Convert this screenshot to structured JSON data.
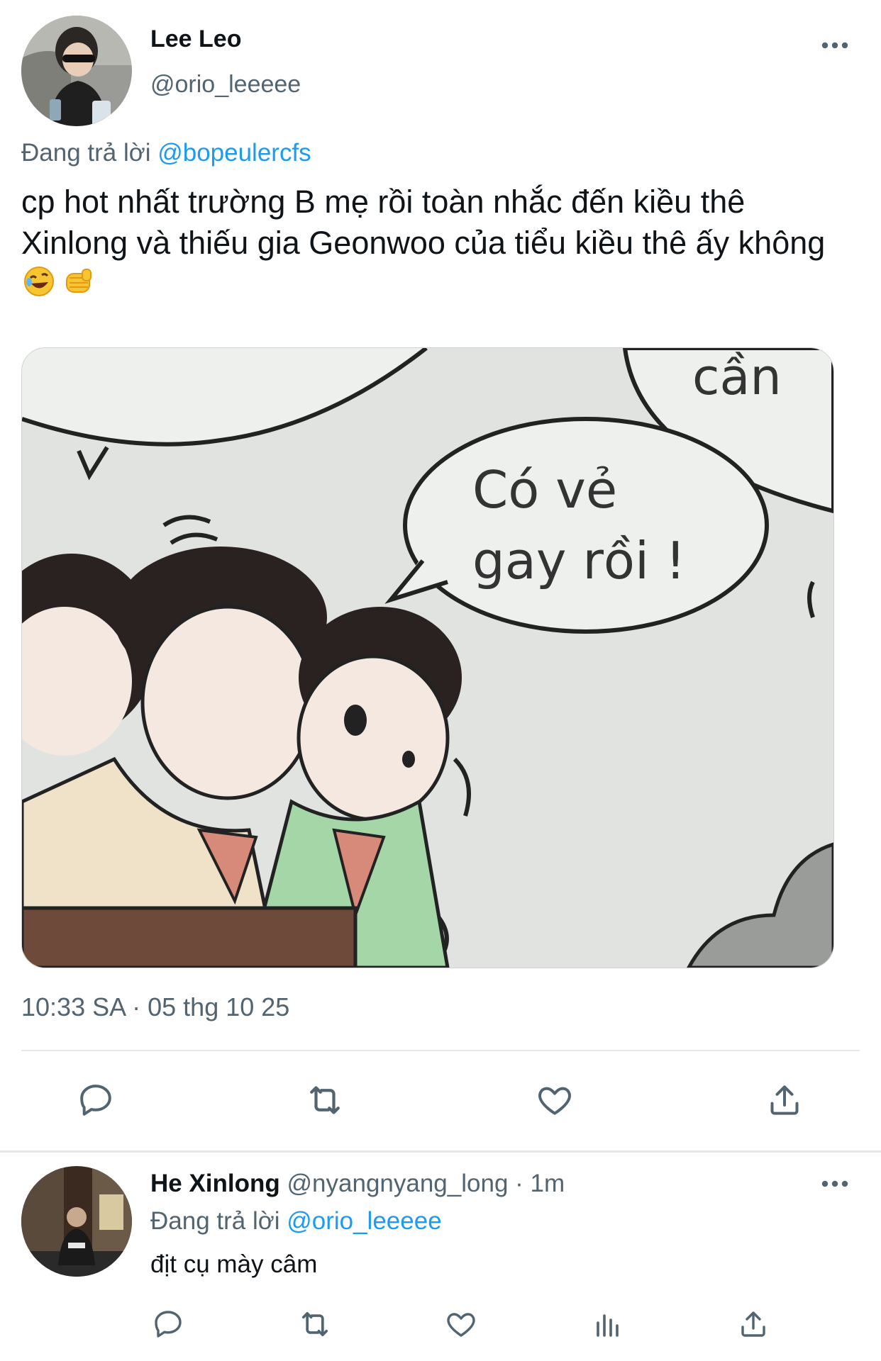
{
  "tweet": {
    "author_name": "Lee Leo",
    "author_handle": "@orio_leeeee",
    "reply_prefix": "Đang trả lời ",
    "reply_to": "@bopeulercfs",
    "text": "cp hot nhất trường B mẹ rồi toàn nhắc đến kiều thê Xinlong và thiếu gia Geonwoo của tiểu kiều thê ấy không",
    "emojis": [
      "rofl-emoji",
      "fist-emoji"
    ],
    "media": {
      "speech_bubble_line1": "Có vẻ",
      "speech_bubble_line2": "gay rồi !",
      "corner_text": "cần"
    },
    "timestamp": "10:33 SA · 05 thg 10 25",
    "actions": [
      "reply-icon",
      "retweet-icon",
      "like-icon",
      "share-icon"
    ]
  },
  "reply": {
    "author_name": "He Xinlong",
    "author_handle": "@nyangnyang_long",
    "separator": " · ",
    "time": "1m",
    "reply_prefix": "Đang trả lời ",
    "reply_to": "@orio_leeeee",
    "text": "địt cụ mày câm",
    "actions": [
      "reply-icon",
      "retweet-icon",
      "like-icon",
      "views-icon",
      "share-icon"
    ]
  },
  "colors": {
    "accent": "#1d9bf0",
    "secondary_text": "#536471",
    "primary_text": "#0f1419",
    "divider": "#e6e9ea"
  }
}
